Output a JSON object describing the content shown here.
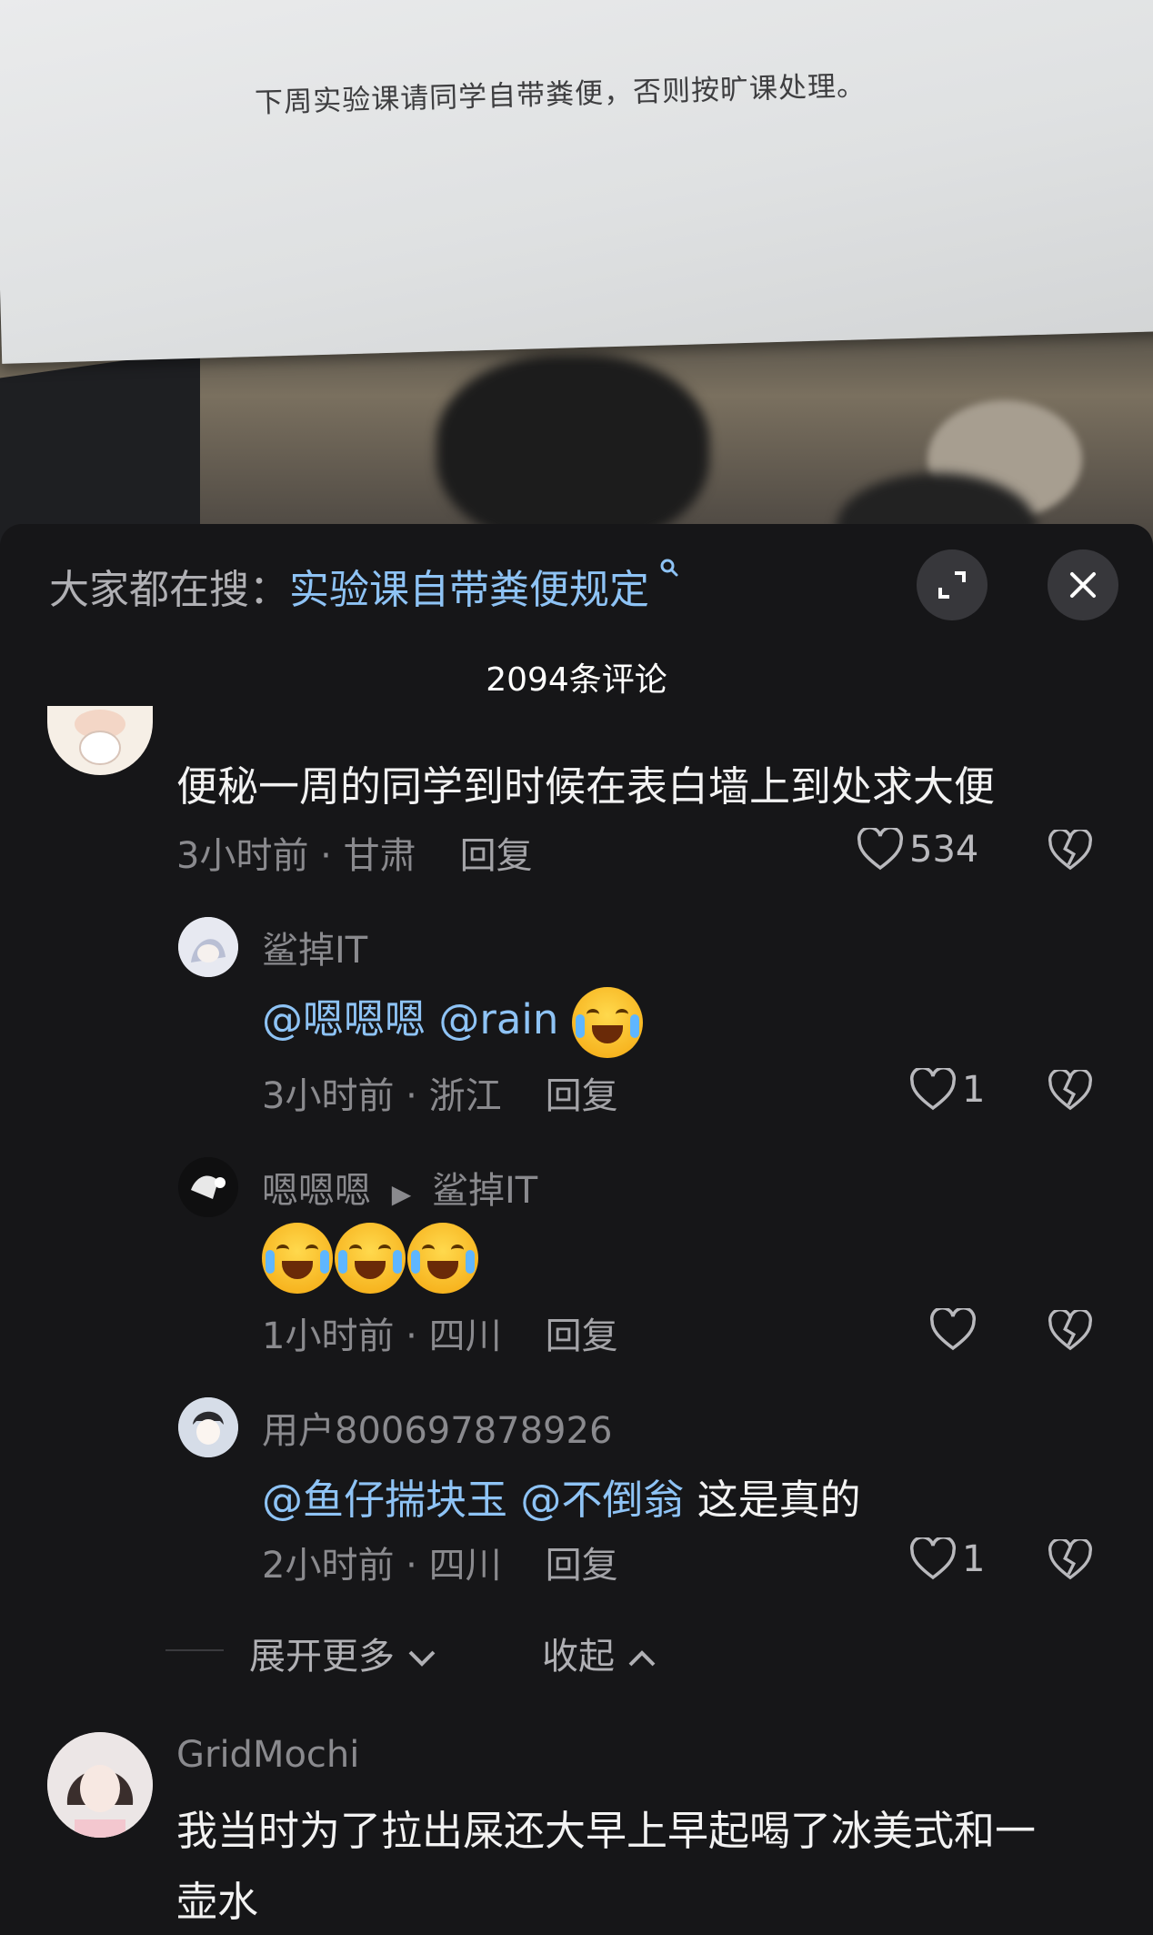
{
  "photo": {
    "notice_text": "下周实验课请同学自带粪便，否则按旷课处理。"
  },
  "search": {
    "prefix": "大家都在搜：",
    "term": "实验课自带粪便规定"
  },
  "comments_count": "2094条评论",
  "comments": [
    {
      "text": "便秘一周的同学到时候在表白墙上到处求大便",
      "time": "3小时前",
      "location": "甘肃",
      "reply": "回复",
      "likes": "534"
    },
    {
      "user": "鲨掉IT",
      "mentions": [
        "@嗯嗯嗯",
        "@rain"
      ],
      "time": "3小时前",
      "location": "浙江",
      "reply": "回复",
      "likes": "1"
    },
    {
      "user": "嗯嗯嗯",
      "reply_to": "鲨掉IT",
      "time": "1小时前",
      "location": "四川",
      "reply": "回复",
      "likes": ""
    },
    {
      "user": "用户800697878926",
      "mentions": [
        "@鱼仔揣块玉",
        "@不倒翁"
      ],
      "text": "这是真的",
      "time": "2小时前",
      "location": "四川",
      "reply": "回复",
      "likes": "1"
    },
    {
      "user": "GridMochi",
      "text_line1": "我当时为了拉出屎还大早上早起喝了冰美式和一",
      "text_line2": "壶水"
    }
  ],
  "controls": {
    "expand_more": "展开更多",
    "collapse": "收起"
  },
  "icons": [
    "search-icon",
    "expand-icon",
    "close-icon",
    "heart-icon",
    "dislike-heart-icon",
    "play-arrow-icon",
    "chevron-down-icon",
    "chevron-up-icon",
    "crying-laughing-emoji"
  ]
}
